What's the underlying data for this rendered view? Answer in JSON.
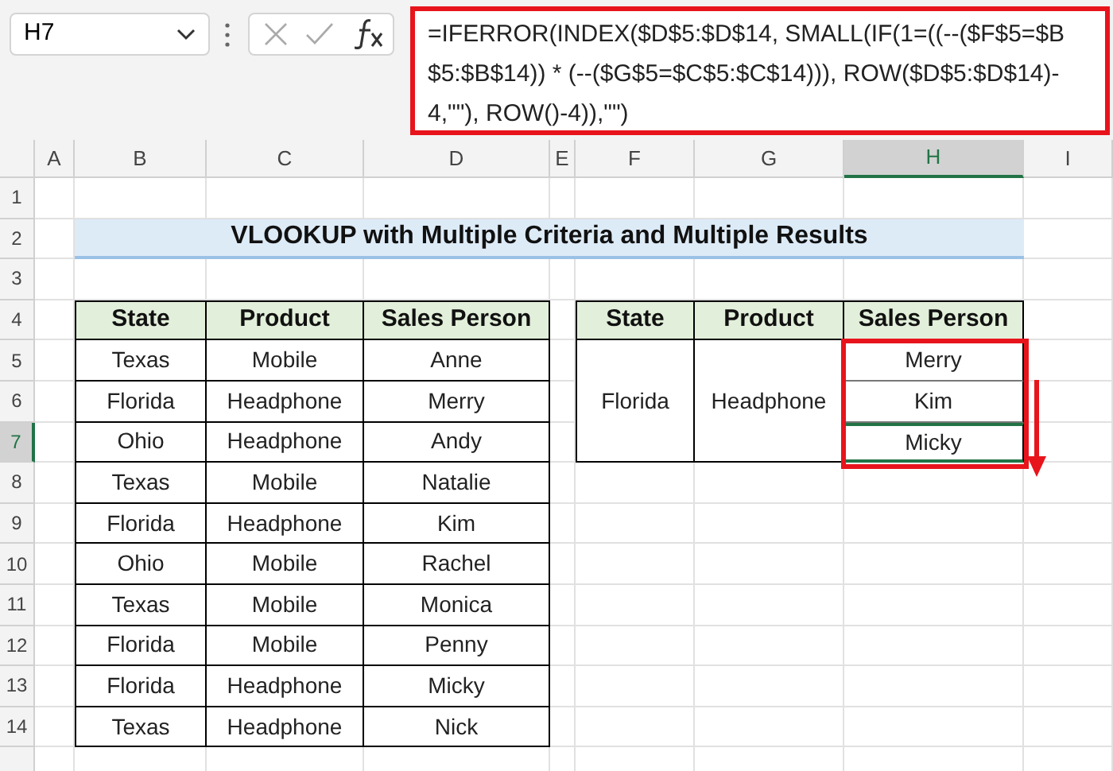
{
  "name_box": "H7",
  "formula": "=IFERROR(INDEX($D$5:$D$14, SMALL(IF(1=((--($F$5=$B$5:$B$14)) * (--($G$5=$C$5:$C$14))), ROW($D$5:$D$14)-4,\"\"), ROW()-4)),\"\")",
  "columns": [
    {
      "label": "A",
      "selected": false
    },
    {
      "label": "B",
      "selected": false
    },
    {
      "label": "C",
      "selected": false
    },
    {
      "label": "D",
      "selected": false
    },
    {
      "label": "E",
      "selected": false
    },
    {
      "label": "F",
      "selected": false
    },
    {
      "label": "G",
      "selected": false
    },
    {
      "label": "H",
      "selected": true
    },
    {
      "label": "I",
      "selected": false
    }
  ],
  "rows": [
    {
      "label": "1",
      "selected": false
    },
    {
      "label": "2",
      "selected": false
    },
    {
      "label": "3",
      "selected": false
    },
    {
      "label": "4",
      "selected": false
    },
    {
      "label": "5",
      "selected": false
    },
    {
      "label": "6",
      "selected": false
    },
    {
      "label": "7",
      "selected": true
    },
    {
      "label": "8",
      "selected": false
    },
    {
      "label": "9",
      "selected": false
    },
    {
      "label": "10",
      "selected": false
    },
    {
      "label": "11",
      "selected": false
    },
    {
      "label": "12",
      "selected": false
    },
    {
      "label": "13",
      "selected": false
    },
    {
      "label": "14",
      "selected": false
    }
  ],
  "title": "VLOOKUP with Multiple Criteria and Multiple Results",
  "data_table": {
    "columns": [
      "State",
      "Product",
      "Sales Person"
    ],
    "rows": [
      [
        "Texas",
        "Mobile",
        "Anne"
      ],
      [
        "Florida",
        "Headphone",
        "Merry"
      ],
      [
        "Ohio",
        "Headphone",
        "Andy"
      ],
      [
        "Texas",
        "Mobile",
        "Natalie"
      ],
      [
        "Florida",
        "Headphone",
        "Kim"
      ],
      [
        "Ohio",
        "Mobile",
        "Rachel"
      ],
      [
        "Texas",
        "Mobile",
        "Monica"
      ],
      [
        "Florida",
        "Mobile",
        "Penny"
      ],
      [
        "Florida",
        "Headphone",
        "Micky"
      ],
      [
        "Texas",
        "Headphone",
        "Nick"
      ]
    ]
  },
  "lookup_table": {
    "columns": [
      "State",
      "Product",
      "Sales Person"
    ],
    "state": "Florida",
    "product": "Headphone",
    "results": [
      {
        "name": "Merry",
        "selected": false
      },
      {
        "name": "Kim",
        "selected": false
      },
      {
        "name": "Micky",
        "selected": true
      }
    ]
  }
}
